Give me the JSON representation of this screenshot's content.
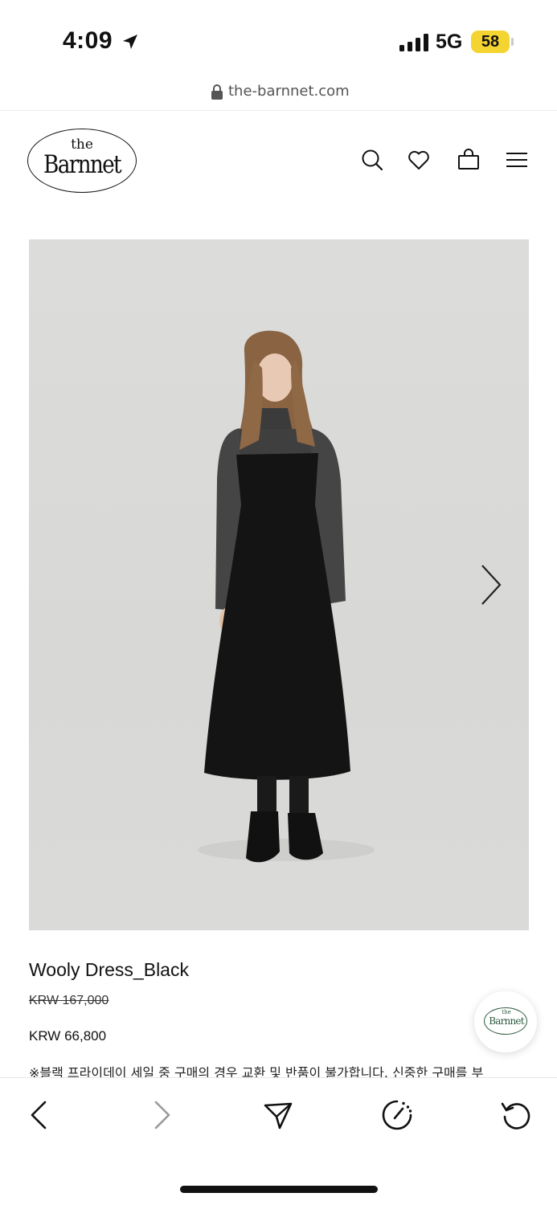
{
  "status": {
    "time": "4:09",
    "network": "5G",
    "battery": "58"
  },
  "url_bar": {
    "domain": "the-barnnet.com"
  },
  "header": {
    "logo_small": "the",
    "logo_name": "Barnnet",
    "icons": [
      "search-icon",
      "heart-icon",
      "shopping-bag-icon",
      "menu-icon"
    ]
  },
  "product": {
    "name": "Wooly Dress_Black",
    "original_price": "KRW 167,000",
    "sale_price": "KRW 66,800",
    "notice": "※블랙 프라이데이 세일 중 구매의 경우 교환 및 반품이 불가합니다. 신중한 구매를 부"
  },
  "chat": {
    "logo_small": "the",
    "logo_name": "Barnnet"
  },
  "toolbar": {
    "icons": [
      "back-icon",
      "forward-icon",
      "share-icon",
      "speed-dial-icon",
      "reload-icon"
    ]
  },
  "colors": {
    "battery": "#f4d430",
    "image_background": "#d9d9d7",
    "chat_logo": "#2c5a3f"
  }
}
